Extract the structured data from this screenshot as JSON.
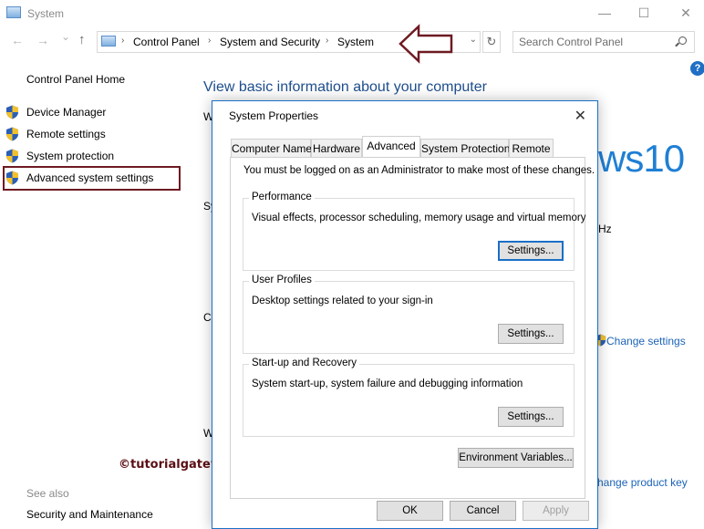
{
  "window": {
    "title": "System",
    "controls": {
      "minimize": "—",
      "maximize": "☐",
      "close": "✕"
    }
  },
  "nav": {
    "back": "←",
    "forward": "→",
    "recent": "⌄",
    "up": "↑",
    "breadcrumbs": [
      "Control Panel",
      "System and Security",
      "System"
    ],
    "search_placeholder": "Search Control Panel",
    "refresh": "↻"
  },
  "help": "?",
  "left_pane": {
    "home": "Control Panel Home",
    "items": [
      {
        "label": "Device Manager"
      },
      {
        "label": "Remote settings"
      },
      {
        "label": "System protection"
      },
      {
        "label": "Advanced system settings"
      }
    ],
    "see_also": "See also",
    "see_also_link": "Security and Maintenance"
  },
  "main": {
    "title": "View basic information about your computer",
    "fragments": {
      "win_edition": "Win",
      "system": "Syst",
      "computer": "Con",
      "windows_activation": "Win",
      "windows10": "ws10",
      "hz": "Hz",
      "change_settings": "Change settings",
      "change_product_key": "hange product key"
    }
  },
  "watermark": "©tutorialgateway.org",
  "dialog": {
    "title": "System Properties",
    "close": "✕",
    "tabs": [
      "Computer Name",
      "Hardware",
      "Advanced",
      "System Protection",
      "Remote"
    ],
    "active_tab": "Advanced",
    "admin_note": "You must be logged on as an Administrator to make most of these changes.",
    "groups": [
      {
        "title": "Performance",
        "desc": "Visual effects, processor scheduling, memory usage and virtual memory",
        "button": "Settings..."
      },
      {
        "title": "User Profiles",
        "desc": "Desktop settings related to your sign-in",
        "button": "Settings..."
      },
      {
        "title": "Start-up and Recovery",
        "desc": "System start-up, system failure and debugging information",
        "button": "Settings..."
      }
    ],
    "env_button": "Environment Variables...",
    "ok": "OK",
    "cancel": "Cancel",
    "apply": "Apply"
  },
  "colors": {
    "accent": "#1a6fc7",
    "highlight_border": "#6e1a22",
    "link": "#1c63b7",
    "title_blue": "#1e4e8c"
  }
}
